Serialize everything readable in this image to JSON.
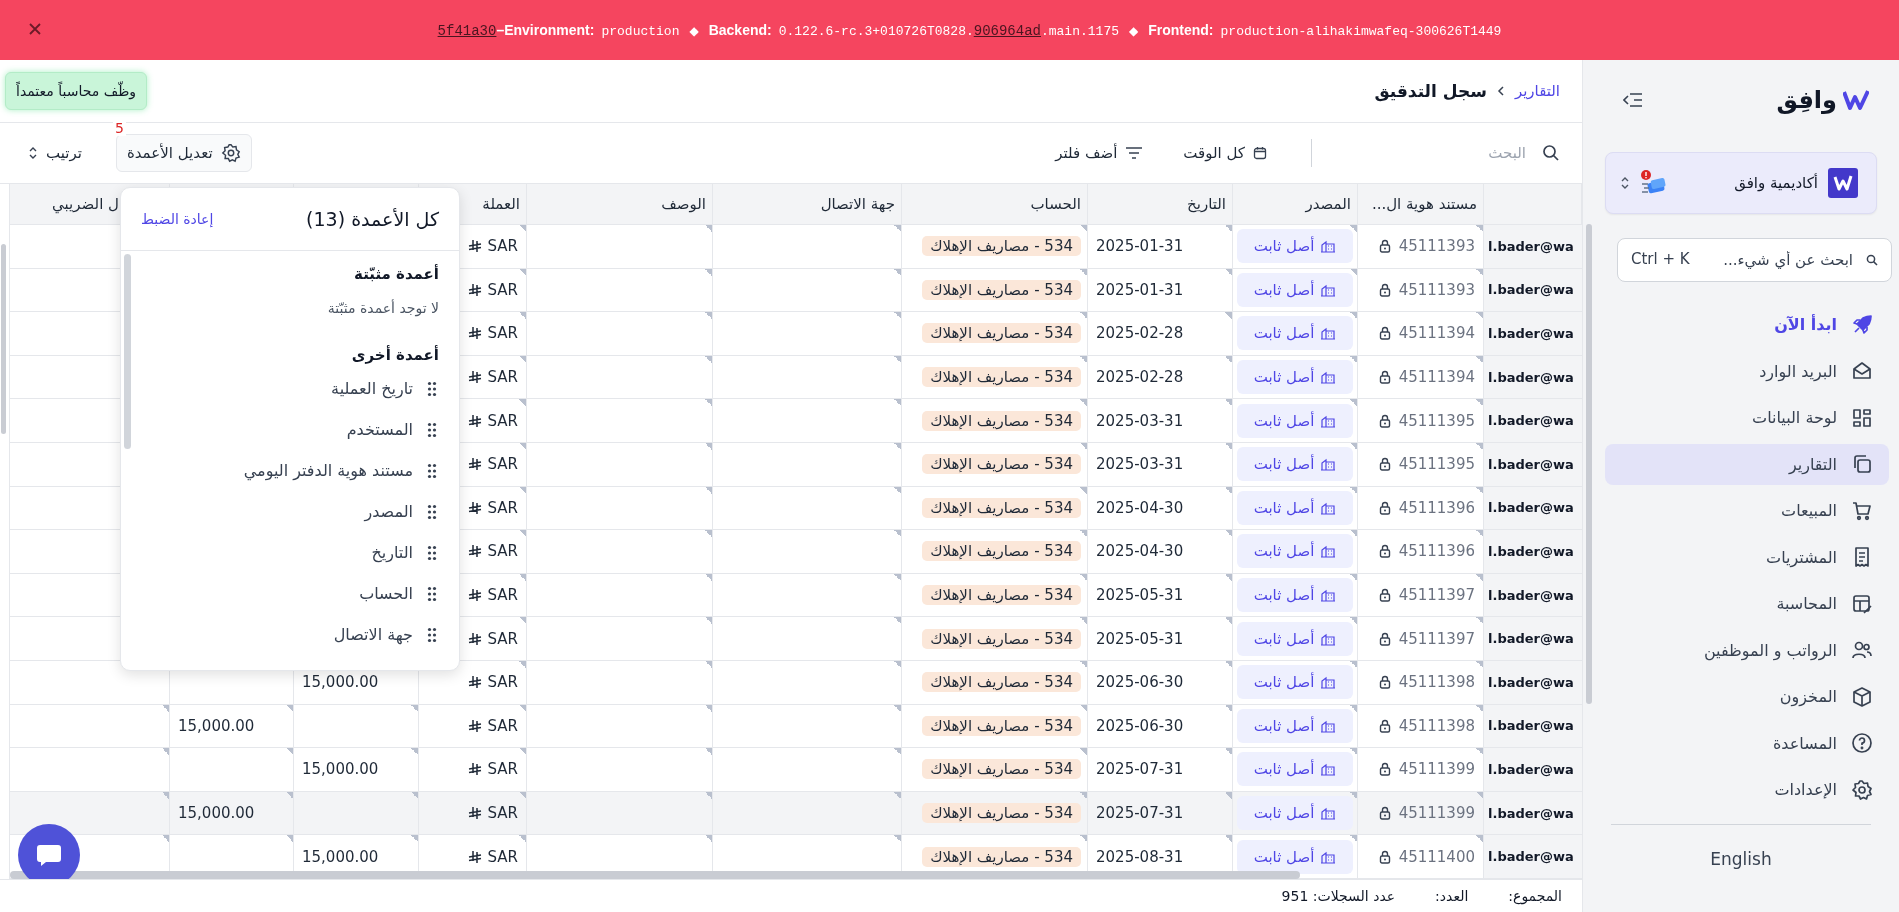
{
  "banner": {
    "commit_link": "5f41a30",
    "environment_label": "–Environment:",
    "environment_value": "production",
    "separator_1": "◆",
    "backend_label": "Backend:",
    "backend_prefix": "0.122.6-rc.3+010726T0828.",
    "backend_link": "906964ad",
    "backend_suffix": ".main.1175",
    "separator_2": "◆",
    "frontend_label": "Frontend:",
    "frontend_value": "production-alihakimwafeq-300626T1449"
  },
  "sidebar": {
    "logo": "وافِق",
    "organization": "أكاديمية وافق",
    "search": {
      "placeholder": "ابحث عن أي شيء...",
      "shortcut": "Ctrl + K"
    },
    "items": [
      {
        "label": "ابدأ الآن",
        "accent": true,
        "selected": false
      },
      {
        "label": "البريد الوارد",
        "accent": false,
        "selected": false
      },
      {
        "label": "لوحة البيانات",
        "accent": false,
        "selected": false
      },
      {
        "label": "التقارير",
        "accent": false,
        "selected": true
      },
      {
        "label": "المبيعات",
        "accent": false,
        "selected": false
      },
      {
        "label": "المشتريات",
        "accent": false,
        "selected": false
      },
      {
        "label": "المحاسبة",
        "accent": false,
        "selected": false
      },
      {
        "label": "الرواتب و الموظفين",
        "accent": false,
        "selected": false
      },
      {
        "label": "المخزون",
        "accent": false,
        "selected": false
      },
      {
        "label": "المساعدة",
        "accent": false,
        "selected": false
      },
      {
        "label": "الإعدادات",
        "accent": false,
        "selected": false
      }
    ],
    "language": "English"
  },
  "header": {
    "breadcrumb": "التقارير",
    "title": "سجل التدقيق",
    "promo": "وظّف محاسباً معتمداً"
  },
  "toolbar": {
    "search": {
      "placeholder": "البحث"
    },
    "period": "كل الوقت",
    "filter": "أضف فلتر",
    "columns_button": "تعديل الأعمدة",
    "columns_badge": "5",
    "sort": "ترتيب"
  },
  "columns_popup": {
    "title": "كل الأعمدة (13)",
    "reset": "إعادة الضبط",
    "pinned_heading": "أعمدة مثبّتة",
    "pinned_empty": "لا توجد أعمدة مثبّتة",
    "other_heading": "أعمدة أخرى",
    "items": [
      "تاريخ العملية",
      "المستخدم",
      "مستند هوية الدفتر اليومي",
      "المصدر",
      "التاريخ",
      "الحساب",
      "جهة الاتصال"
    ]
  },
  "table": {
    "columns": [
      {
        "kind": "user"
      },
      {
        "kind": "id",
        "label": "مستند هوية ال..."
      },
      {
        "kind": "source",
        "label": "المصدر"
      },
      {
        "kind": "date",
        "label": "التاريخ"
      },
      {
        "kind": "account",
        "label": "الحساب"
      },
      {
        "kind": "contact",
        "label": "جهة الاتصال"
      },
      {
        "kind": "description",
        "label": "الوصف"
      },
      {
        "kind": "currency",
        "label": "العملة"
      },
      {
        "kind": "column_9"
      },
      {
        "kind": "column_10"
      },
      {
        "kind": "tax",
        "label": "ل الضريبي"
      }
    ],
    "rows": [
      {
        "user": "l.bader@wa",
        "id": "45111393",
        "source": "أصل ثابت",
        "date": "2025-01-31",
        "account": "534 - مصاريف الإهلاك",
        "currency": "SAR",
        "highlighted": false
      },
      {
        "user": "l.bader@wa",
        "id": "45111393",
        "source": "أصل ثابت",
        "date": "2025-01-31",
        "account": "534 - مصاريف الإهلاك",
        "currency": "SAR",
        "highlighted": false
      },
      {
        "user": "l.bader@wa",
        "id": "45111394",
        "source": "أصل ثابت",
        "date": "2025-02-28",
        "account": "534 - مصاريف الإهلاك",
        "currency": "SAR",
        "highlighted": false
      },
      {
        "user": "l.bader@wa",
        "id": "45111394",
        "source": "أصل ثابت",
        "date": "2025-02-28",
        "account": "534 - مصاريف الإهلاك",
        "currency": "SAR",
        "highlighted": false
      },
      {
        "user": "l.bader@wa",
        "id": "45111395",
        "source": "أصل ثابت",
        "date": "2025-03-31",
        "account": "534 - مصاريف الإهلاك",
        "currency": "SAR",
        "highlighted": false
      },
      {
        "user": "l.bader@wa",
        "id": "45111395",
        "source": "أصل ثابت",
        "date": "2025-03-31",
        "account": "534 - مصاريف الإهلاك",
        "currency": "SAR",
        "highlighted": false
      },
      {
        "user": "l.bader@wa",
        "id": "45111396",
        "source": "أصل ثابت",
        "date": "2025-04-30",
        "account": "534 - مصاريف الإهلاك",
        "currency": "SAR",
        "highlighted": false
      },
      {
        "user": "l.bader@wa",
        "id": "45111396",
        "source": "أصل ثابت",
        "date": "2025-04-30",
        "account": "534 - مصاريف الإهلاك",
        "currency": "SAR",
        "highlighted": false
      },
      {
        "user": "l.bader@wa",
        "id": "45111397",
        "source": "أصل ثابت",
        "date": "2025-05-31",
        "account": "534 - مصاريف الإهلاك",
        "currency": "SAR",
        "highlighted": false
      },
      {
        "user": "l.bader@wa",
        "id": "45111397",
        "source": "أصل ثابت",
        "date": "2025-05-31",
        "account": "534 - مصاريف الإهلاك",
        "currency": "SAR",
        "highlighted": false
      },
      {
        "user": "l.bader@wa",
        "id": "45111398",
        "source": "أصل ثابت",
        "date": "2025-06-30",
        "account": "534 - مصاريف الإهلاك",
        "currency": "SAR",
        "column_9": "15,000.00",
        "highlighted": false
      },
      {
        "user": "l.bader@wa",
        "id": "45111398",
        "source": "أصل ثابت",
        "date": "2025-06-30",
        "account": "534 - مصاريف الإهلاك",
        "currency": "SAR",
        "column_10": "15,000.00",
        "highlighted": false
      },
      {
        "user": "l.bader@wa",
        "id": "45111399",
        "source": "أصل ثابت",
        "date": "2025-07-31",
        "account": "534 - مصاريف الإهلاك",
        "currency": "SAR",
        "column_9": "15,000.00",
        "highlighted": false
      },
      {
        "user": "l.bader@wa",
        "id": "45111399",
        "source": "أصل ثابت",
        "date": "2025-07-31",
        "account": "534 - مصاريف الإهلاك",
        "currency": "SAR",
        "column_10": "15,000.00",
        "highlighted": true
      },
      {
        "user": "l.bader@wa",
        "id": "45111400",
        "source": "أصل ثابت",
        "date": "2025-08-31",
        "account": "534 - مصاريف الإهلاك",
        "currency": "SAR",
        "column_9": "15,000.00",
        "highlighted": false
      }
    ]
  },
  "footer": {
    "total_label": "المجموع:",
    "count_label": "العدد:",
    "records": "عدد السجلات: 951"
  }
}
